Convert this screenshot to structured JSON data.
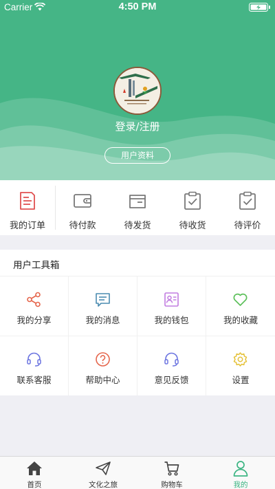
{
  "status_bar": {
    "carrier": "Carrier",
    "time": "4:50 PM"
  },
  "header": {
    "login_text": "登录/注册",
    "profile_button": "用户资料",
    "background_color": "#45b586"
  },
  "orders": [
    {
      "label": "我的订单",
      "icon": "my-orders-icon"
    },
    {
      "label": "待付款",
      "icon": "wallet-icon"
    },
    {
      "label": "待发货",
      "icon": "shipping-box-icon"
    },
    {
      "label": "待收货",
      "icon": "clipboard-check-icon"
    },
    {
      "label": "待评价",
      "icon": "review-check-icon"
    }
  ],
  "toolbox": {
    "title": "用户工具箱",
    "items": [
      {
        "label": "我的分享",
        "icon": "share-icon",
        "color": "#e5654b"
      },
      {
        "label": "我的消息",
        "icon": "message-icon",
        "color": "#4a8bb0"
      },
      {
        "label": "我的钱包",
        "icon": "wallet-card-icon",
        "color": "#c17be0"
      },
      {
        "label": "我的收藏",
        "icon": "heart-icon",
        "color": "#5cc05a"
      },
      {
        "label": "联系客服",
        "icon": "headset-icon",
        "color": "#6b74e0"
      },
      {
        "label": "帮助中心",
        "icon": "help-icon",
        "color": "#e5654b"
      },
      {
        "label": "意见反馈",
        "icon": "feedback-headset-icon",
        "color": "#6b74e0"
      },
      {
        "label": "设置",
        "icon": "gear-icon",
        "color": "#e5c23a"
      }
    ]
  },
  "tabbar": [
    {
      "label": "首页",
      "icon": "home-icon",
      "active": false
    },
    {
      "label": "文化之旅",
      "icon": "paper-plane-icon",
      "active": false
    },
    {
      "label": "购物车",
      "icon": "cart-icon",
      "active": false
    },
    {
      "label": "我的",
      "icon": "user-icon",
      "active": true
    }
  ],
  "accent_color": "#3cb583"
}
